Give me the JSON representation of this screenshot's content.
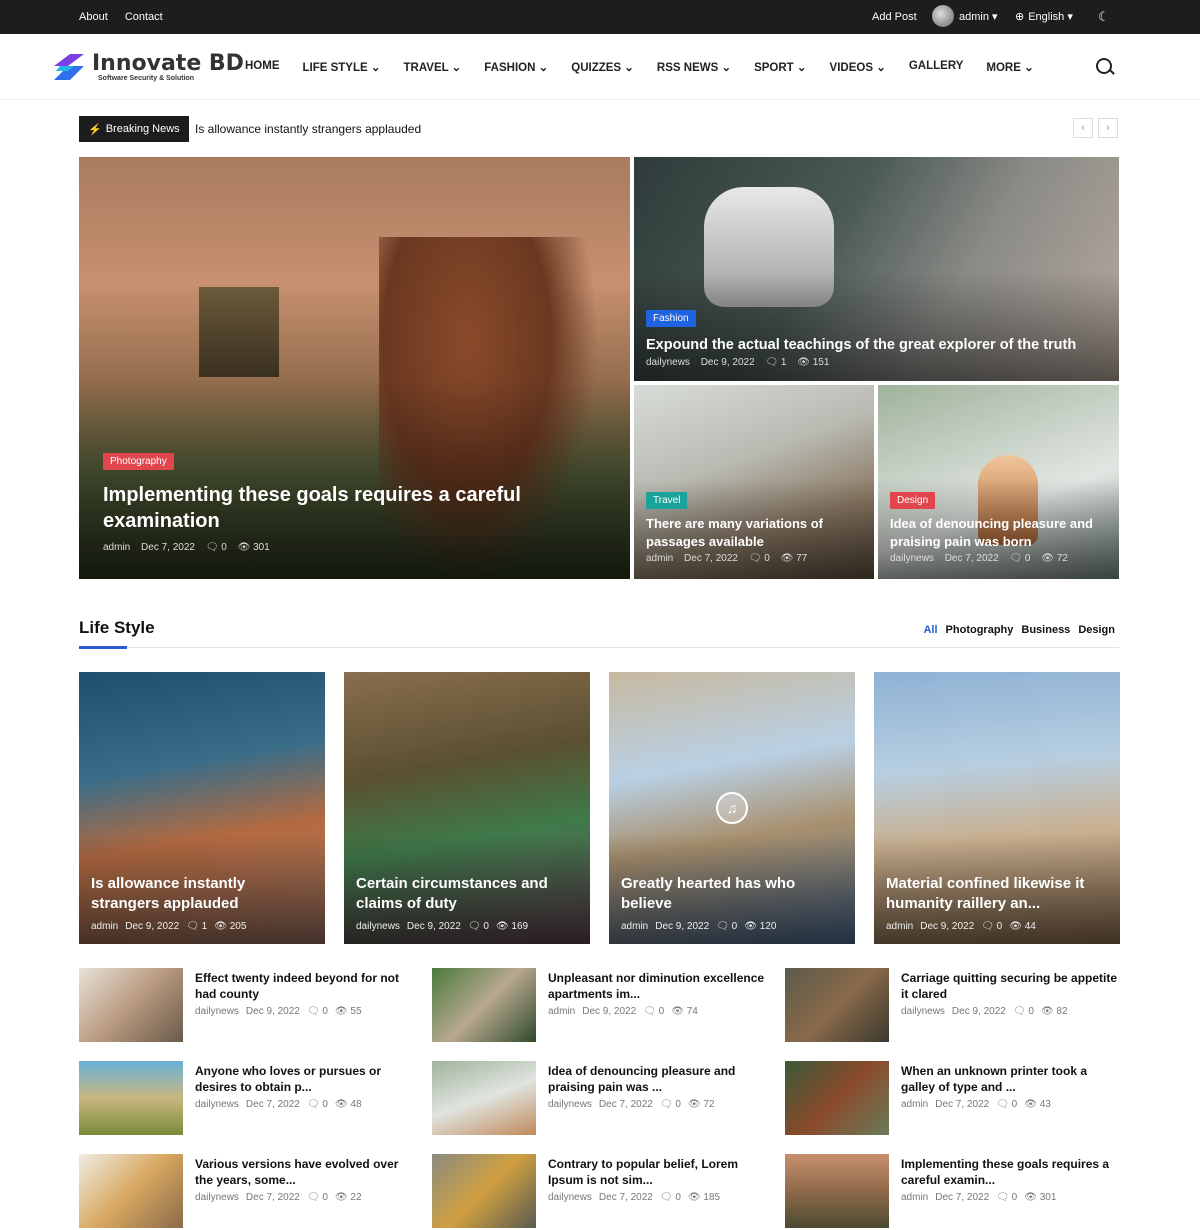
{
  "topbar": {
    "links": [
      "About",
      "Contact"
    ],
    "add_post": "Add Post",
    "user": "admin ▾",
    "language": "English ▾"
  },
  "logo": {
    "name": "Innovate BD",
    "tagline": "Software Security & Solution"
  },
  "nav": [
    "HOME",
    "LIFE STYLE ⌄",
    "TRAVEL ⌄",
    "FASHION ⌄",
    "QUIZZES ⌄",
    "RSS NEWS ⌄",
    "SPORT ⌄",
    "VIDEOS ⌄",
    "GALLERY",
    "MORE ⌄"
  ],
  "breaking": {
    "label": "Breaking News",
    "text": "Is allowance instantly strangers applauded"
  },
  "hero": {
    "main": {
      "category": "Photography",
      "title": "Implementing these goals requires a careful examination",
      "author": "admin",
      "date": "Dec 7, 2022",
      "comments": "0",
      "views": "301"
    },
    "top": {
      "category": "Fashion",
      "title": "Expound the actual teachings of the great explorer of the truth",
      "author": "dailynews",
      "date": "Dec 9, 2022",
      "comments": "1",
      "views": "151"
    },
    "left": {
      "category": "Travel",
      "title": "There are many variations of passages available",
      "author": "admin",
      "date": "Dec 7, 2022",
      "comments": "0",
      "views": "77"
    },
    "right": {
      "category": "Design",
      "title": "Idea of denouncing pleasure and praising pain was born",
      "author": "dailynews",
      "date": "Dec 7, 2022",
      "comments": "0",
      "views": "72"
    }
  },
  "section": {
    "title": "Life Style",
    "tabs": [
      "All",
      "Photography",
      "Business",
      "Design"
    ]
  },
  "cards": [
    {
      "title": "Is allowance instantly strangers applauded",
      "author": "admin",
      "date": "Dec 9, 2022",
      "comments": "1",
      "views": "205"
    },
    {
      "title": "Certain circumstances and claims of duty",
      "author": "dailynews",
      "date": "Dec 9, 2022",
      "comments": "0",
      "views": "169"
    },
    {
      "title": "Greatly hearted has who believe",
      "author": "admin",
      "date": "Dec 9, 2022",
      "comments": "0",
      "views": "120"
    },
    {
      "title": "Material confined likewise it humanity raillery an...",
      "author": "admin",
      "date": "Dec 9, 2022",
      "comments": "0",
      "views": "44"
    }
  ],
  "small_posts": [
    {
      "title": "Effect twenty indeed beyond for not had county",
      "author": "dailynews",
      "date": "Dec 9, 2022",
      "comments": "0",
      "views": "55"
    },
    {
      "title": "Unpleasant nor diminution excellence apartments im...",
      "author": "admin",
      "date": "Dec 9, 2022",
      "comments": "0",
      "views": "74"
    },
    {
      "title": "Carriage quitting securing be appetite it clared",
      "author": "dailynews",
      "date": "Dec 9, 2022",
      "comments": "0",
      "views": "82"
    },
    {
      "title": "Anyone who loves or pursues or desires to obtain p...",
      "author": "dailynews",
      "date": "Dec 7, 2022",
      "comments": "0",
      "views": "48"
    },
    {
      "title": "Idea of denouncing pleasure and praising pain was ...",
      "author": "dailynews",
      "date": "Dec 7, 2022",
      "comments": "0",
      "views": "72"
    },
    {
      "title": "When an unknown printer took a galley of type and ...",
      "author": "admin",
      "date": "Dec 7, 2022",
      "comments": "0",
      "views": "43"
    },
    {
      "title": "Various versions have evolved over the years, some...",
      "author": "dailynews",
      "date": "Dec 7, 2022",
      "comments": "0",
      "views": "22"
    },
    {
      "title": "Contrary to popular belief, Lorem Ipsum is not sim...",
      "author": "dailynews",
      "date": "Dec 7, 2022",
      "comments": "0",
      "views": "185"
    },
    {
      "title": "Implementing these goals requires a careful examin...",
      "author": "admin",
      "date": "Dec 7, 2022",
      "comments": "0",
      "views": "301"
    }
  ],
  "colors": {
    "accent": "#2b5cd6",
    "dark": "#1d1d1f",
    "photography": "#e0464b",
    "fashion": "#1f63e0",
    "travel": "#1aa39a",
    "design": "#e0464b"
  }
}
